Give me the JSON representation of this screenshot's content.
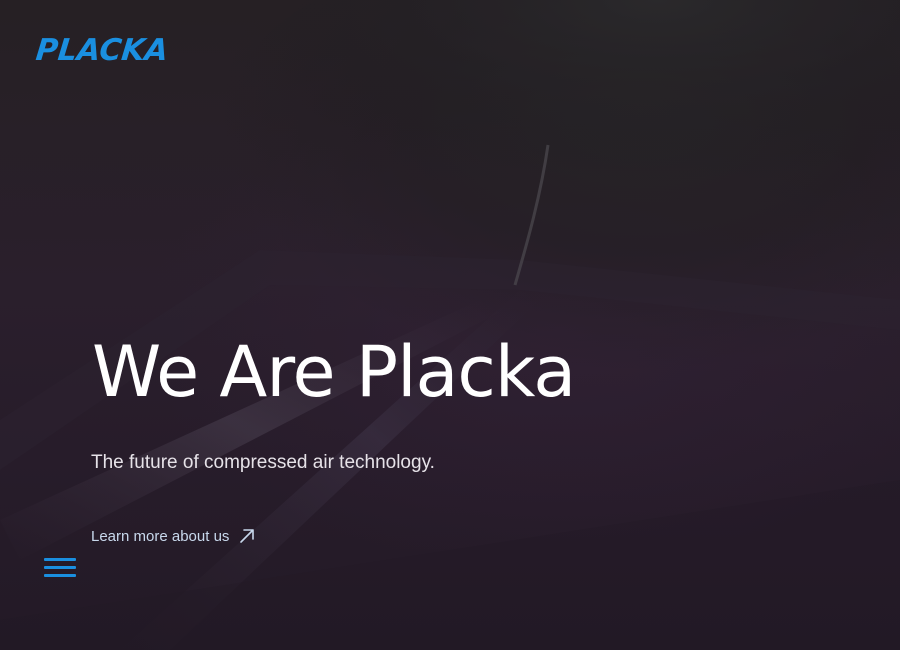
{
  "header": {
    "logo_text": "PLACKA"
  },
  "hero": {
    "headline": "We Are Placka",
    "subheadline": "The future of compressed air technology.",
    "cta_label": "Learn more about us",
    "cta_icon": "arrow-up-right-icon"
  },
  "nav": {
    "menu_icon": "hamburger-menu-icon"
  },
  "colors": {
    "brand_blue": "#1a8fe0",
    "background": "#221a24",
    "headline_text": "#ffffff",
    "link_text": "#c8d8ec"
  }
}
